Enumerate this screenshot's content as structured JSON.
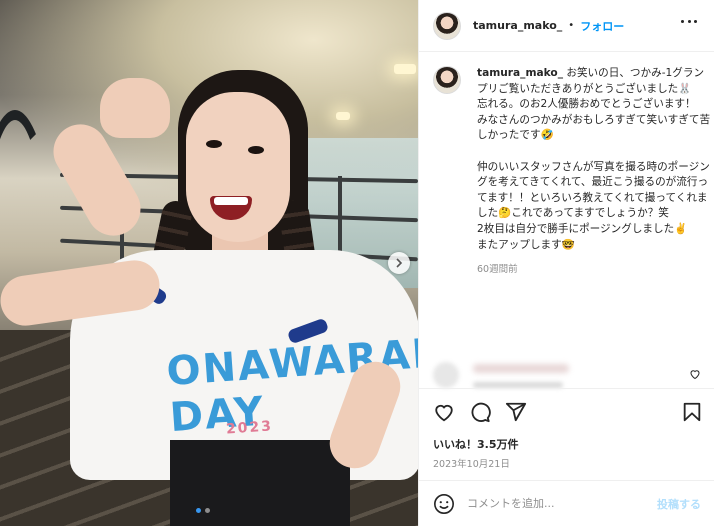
{
  "post": {
    "username": "tamura_mako_",
    "separator": "•",
    "follow_label": "フォロー",
    "more_icon": "more-horizontal-icon",
    "caption": "お笑いの日、つかみ-1グランプリご覧いただきありがとうございました🐰\n忘れる。のお2人優勝おめでとうございます！\nみなさんのつかみがおもしろすぎて笑いすぎて苦しかったです🤣\n\n仲のいいスタッフさんが写真を撮る時のポージングを考えてきてくれて、最近こう撮るのが流行ってます！！といろいろ教えてくれて撮ってくれました🤔これであってますでしょうか？笑\n2枚目は自分で勝手にポージングしました✌️\nまたアップします🤓",
    "time_ago": "60週間前",
    "likes": "いいね！3.5万件",
    "date": "2023年10月21日",
    "comment_placeholder": "コメントを追加...",
    "post_button": "投稿する"
  },
  "photo": {
    "shirt_print": "ONAWARAI DAY",
    "shirt_year": "2023",
    "carousel_index": 1,
    "carousel_total": 2
  },
  "icons": {
    "like": "heart-icon",
    "comment": "comment-icon",
    "share": "send-icon",
    "save": "bookmark-icon",
    "emoji": "smiley-icon",
    "next": "chevron-right-icon"
  },
  "colors": {
    "accent": "#0095f6",
    "post_disabled": "#b2dffc",
    "carousel_active": "#3897f0"
  }
}
